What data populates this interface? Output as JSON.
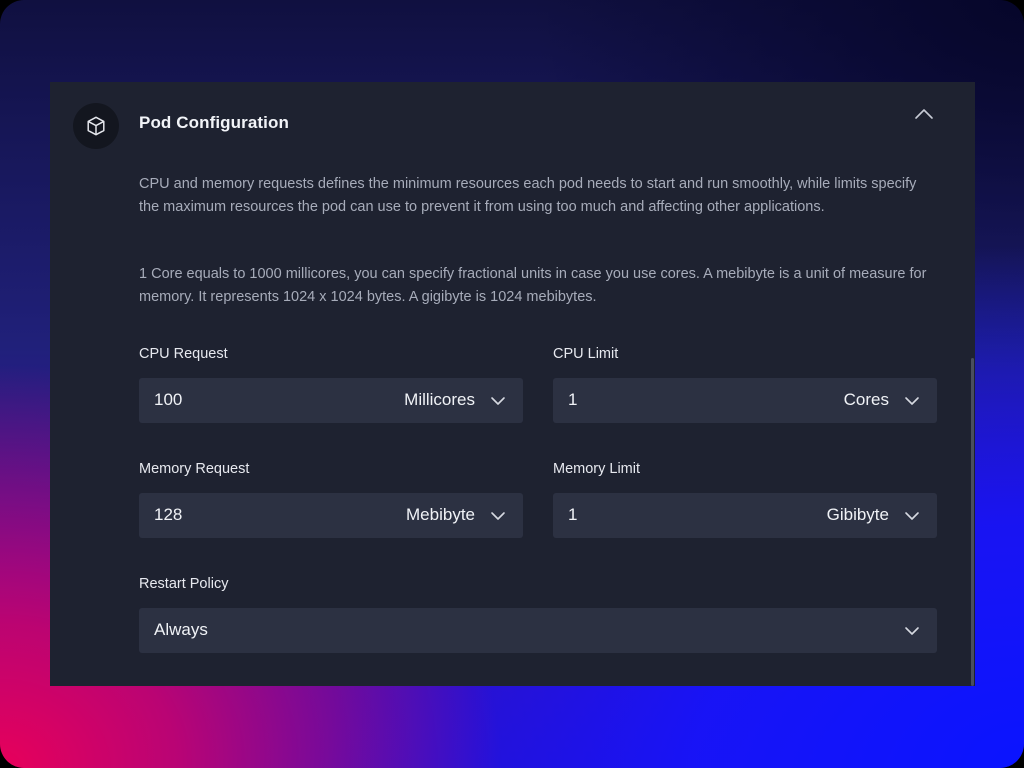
{
  "panel": {
    "title": "Pod Configuration",
    "description_1": "CPU and memory requests defines the minimum resources each pod needs to start and run smoothly, while limits specify the maximum resources the pod can use to prevent it from using too much and affecting other applications.",
    "description_2": "1 Core equals to 1000 millicores, you can specify fractional units in case you use cores. A mebibyte is a unit of measure for memory. It represents 1024 x 1024 bytes. A gigibyte is 1024 mebibytes."
  },
  "fields": {
    "cpu_request": {
      "label": "CPU Request",
      "value": "100",
      "unit": "Millicores"
    },
    "cpu_limit": {
      "label": "CPU Limit",
      "value": "1",
      "unit": "Cores"
    },
    "memory_request": {
      "label": "Memory Request",
      "value": "128",
      "unit": "Mebibyte"
    },
    "memory_limit": {
      "label": "Memory Limit",
      "value": "1",
      "unit": "Gibibyte"
    },
    "restart_policy": {
      "label": "Restart Policy",
      "value": "Always"
    }
  },
  "icons": {
    "header": "cube-icon",
    "collapse": "chevron-up-icon",
    "dropdown": "chevron-down-icon"
  },
  "colors": {
    "panel_bg": "#1e2230",
    "field_bg": "#2c3142",
    "text_primary": "#f0f2f6",
    "text_muted": "#a7acba"
  }
}
